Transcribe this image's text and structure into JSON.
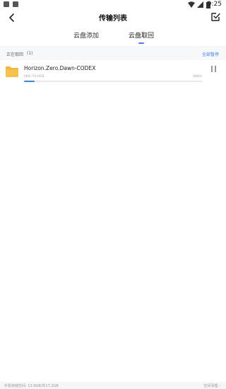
{
  "status_bar": {
    "time": "9:25"
  },
  "header": {
    "title": "传输列表"
  },
  "tabs": [
    {
      "label": "云盘添加",
      "active": false
    },
    {
      "label": "云盘取回",
      "active": true
    }
  ],
  "section": {
    "title": "正在取回",
    "count": "(1)",
    "action": "全部暂停"
  },
  "downloads": [
    {
      "name": "Horizon.Zero.Dawn-CODEX",
      "size": "0KB /70.0GB",
      "speed": "0KB/s",
      "progress": 0.06
    }
  ],
  "footer": {
    "storage": "手机存储空间: 13.9GB/共17.2GB",
    "cleanup": "空间清理 ›"
  },
  "colors": {
    "accent": "#3b84f0",
    "folder": "#f5b53a"
  }
}
